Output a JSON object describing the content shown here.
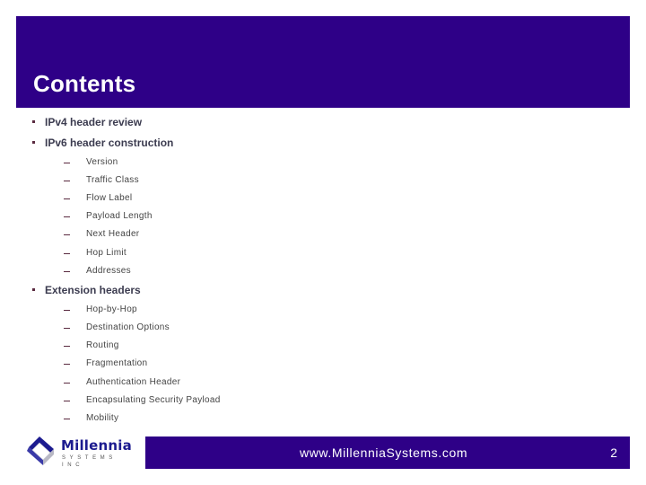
{
  "slide": {
    "title": "Contents",
    "page_number": "2"
  },
  "outline": {
    "items": [
      {
        "label": "IPv4 header review",
        "subitems": []
      },
      {
        "label": "IPv6 header construction",
        "subitems": [
          "Version",
          "Traffic Class",
          "Flow Label",
          "Payload Length",
          "Next Header",
          "Hop Limit",
          "Addresses"
        ]
      },
      {
        "label": "Extension headers",
        "subitems": [
          "Hop-by-Hop",
          "Destination Options",
          "Routing",
          "Fragmentation",
          "Authentication Header",
          "Encapsulating Security Payload",
          "Mobility"
        ]
      }
    ]
  },
  "footer": {
    "url": "www.MillenniaSystems.com",
    "logo_name": "Millennia",
    "logo_tagline": "SYSTEMS INC",
    "logo_icon": "millennia-cube-logo-icon"
  },
  "colors": {
    "band": "#2e0087",
    "bullet": "#5a2a40",
    "text": "#3c3c50"
  }
}
